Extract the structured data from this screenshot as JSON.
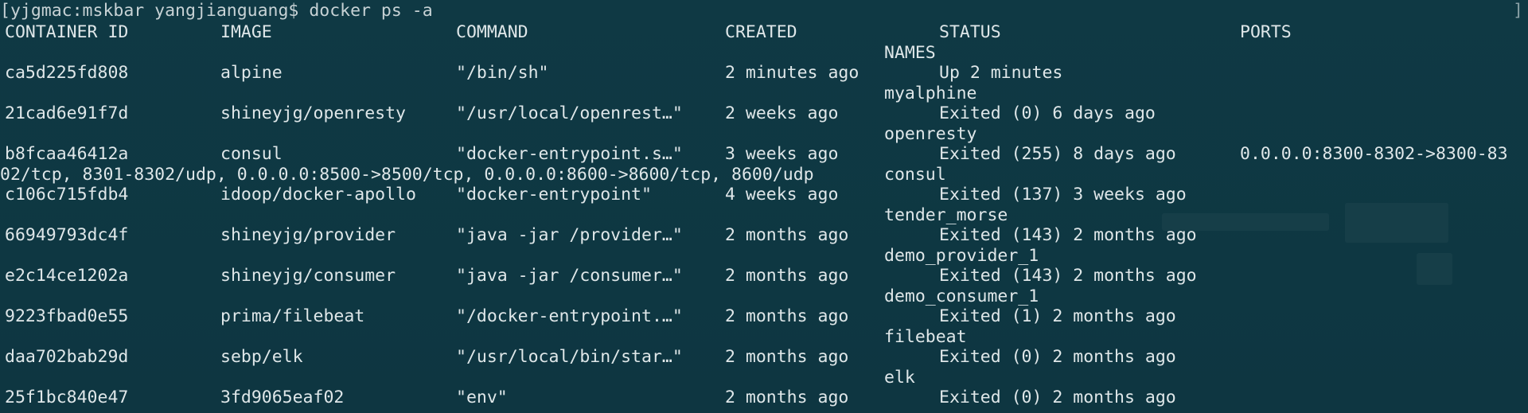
{
  "terminal": {
    "prompt_line": "[yjgmac:mskbar yangjianguang$ docker ps -a",
    "right_bracket": "]"
  },
  "table": {
    "headers": {
      "container_id": "CONTAINER ID",
      "image": "IMAGE",
      "command": "COMMAND",
      "created": "CREATED",
      "status": "STATUS",
      "ports": "PORTS",
      "names": "NAMES"
    },
    "rows": [
      {
        "container_id": "ca5d225fd808",
        "image": "alpine",
        "command": "\"/bin/sh\"",
        "created": "2 minutes ago",
        "status": "Up 2 minutes",
        "ports": "",
        "ports_cont": "",
        "name": "myalphine"
      },
      {
        "container_id": "21cad6e91f7d",
        "image": "shineyjg/openresty",
        "command": "\"/usr/local/openrest…\"",
        "created": "2 weeks ago",
        "status": "Exited (0) 6 days ago",
        "ports": "",
        "ports_cont": "",
        "name": "openresty"
      },
      {
        "container_id": "b8fcaa46412a",
        "image": "consul",
        "command": "\"docker-entrypoint.s…\"",
        "created": "3 weeks ago",
        "status": "Exited (255) 8 days ago",
        "ports": "0.0.0.0:8300-8302->8300-83",
        "ports_cont": "02/tcp, 8301-8302/udp, 0.0.0.0:8500->8500/tcp, 0.0.0.0:8600->8600/tcp, 8600/udp",
        "name": "consul"
      },
      {
        "container_id": "c106c715fdb4",
        "image": "idoop/docker-apollo",
        "command": "\"docker-entrypoint\"",
        "created": "4 weeks ago",
        "status": "Exited (137) 3 weeks ago",
        "ports": "",
        "ports_cont": "",
        "name": "tender_morse"
      },
      {
        "container_id": "66949793dc4f",
        "image": "shineyjg/provider",
        "command": "\"java -jar /provider…\"",
        "created": "2 months ago",
        "status": "Exited (143) 2 months ago",
        "ports": "",
        "ports_cont": "",
        "name": "demo_provider_1"
      },
      {
        "container_id": "e2c14ce1202a",
        "image": "shineyjg/consumer",
        "command": "\"java -jar /consumer…\"",
        "created": "2 months ago",
        "status": "Exited (143) 2 months ago",
        "ports": "",
        "ports_cont": "",
        "name": "demo_consumer_1"
      },
      {
        "container_id": "9223fbad0e55",
        "image": "prima/filebeat",
        "command": "\"/docker-entrypoint.…\"",
        "created": "2 months ago",
        "status": "Exited (1) 2 months ago",
        "ports": "",
        "ports_cont": "",
        "name": "filebeat"
      },
      {
        "container_id": "daa702bab29d",
        "image": "sebp/elk",
        "command": "\"/usr/local/bin/star…\"",
        "created": "2 months ago",
        "status": "Exited (0) 2 months ago",
        "ports": "",
        "ports_cont": "",
        "name": "elk"
      },
      {
        "container_id": "25f1bc840e47",
        "image": "3fd9065eaf02",
        "command": "\"env\"",
        "created": "2 months ago",
        "status": "Exited (0) 2 months ago",
        "ports": "",
        "ports_cont": "",
        "name": ""
      }
    ]
  },
  "colors": {
    "background": "#0e3843",
    "foreground": "#dfe7e9"
  }
}
